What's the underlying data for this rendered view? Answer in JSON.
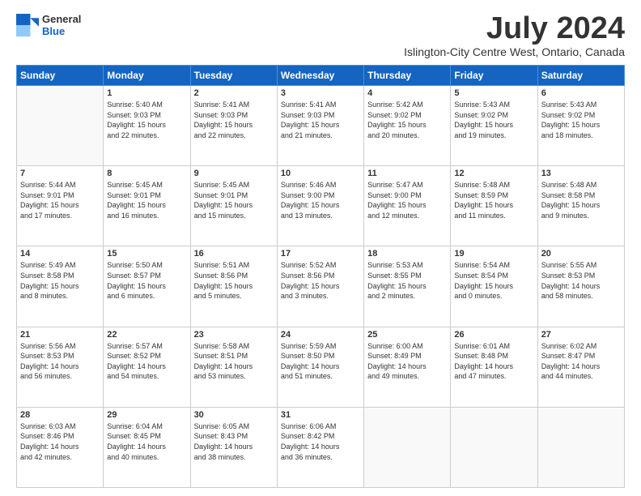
{
  "logo": {
    "line1": "General",
    "line2": "Blue"
  },
  "title": "July 2024",
  "subtitle": "Islington-City Centre West, Ontario, Canada",
  "weekdays": [
    "Sunday",
    "Monday",
    "Tuesday",
    "Wednesday",
    "Thursday",
    "Friday",
    "Saturday"
  ],
  "weeks": [
    [
      {
        "day": "",
        "sunrise": "",
        "sunset": "",
        "daylight": ""
      },
      {
        "day": "1",
        "sunrise": "Sunrise: 5:40 AM",
        "sunset": "Sunset: 9:03 PM",
        "daylight": "Daylight: 15 hours and 22 minutes."
      },
      {
        "day": "2",
        "sunrise": "Sunrise: 5:41 AM",
        "sunset": "Sunset: 9:03 PM",
        "daylight": "Daylight: 15 hours and 22 minutes."
      },
      {
        "day": "3",
        "sunrise": "Sunrise: 5:41 AM",
        "sunset": "Sunset: 9:03 PM",
        "daylight": "Daylight: 15 hours and 21 minutes."
      },
      {
        "day": "4",
        "sunrise": "Sunrise: 5:42 AM",
        "sunset": "Sunset: 9:02 PM",
        "daylight": "Daylight: 15 hours and 20 minutes."
      },
      {
        "day": "5",
        "sunrise": "Sunrise: 5:43 AM",
        "sunset": "Sunset: 9:02 PM",
        "daylight": "Daylight: 15 hours and 19 minutes."
      },
      {
        "day": "6",
        "sunrise": "Sunrise: 5:43 AM",
        "sunset": "Sunset: 9:02 PM",
        "daylight": "Daylight: 15 hours and 18 minutes."
      }
    ],
    [
      {
        "day": "7",
        "sunrise": "Sunrise: 5:44 AM",
        "sunset": "Sunset: 9:01 PM",
        "daylight": "Daylight: 15 hours and 17 minutes."
      },
      {
        "day": "8",
        "sunrise": "Sunrise: 5:45 AM",
        "sunset": "Sunset: 9:01 PM",
        "daylight": "Daylight: 15 hours and 16 minutes."
      },
      {
        "day": "9",
        "sunrise": "Sunrise: 5:45 AM",
        "sunset": "Sunset: 9:01 PM",
        "daylight": "Daylight: 15 hours and 15 minutes."
      },
      {
        "day": "10",
        "sunrise": "Sunrise: 5:46 AM",
        "sunset": "Sunset: 9:00 PM",
        "daylight": "Daylight: 15 hours and 13 minutes."
      },
      {
        "day": "11",
        "sunrise": "Sunrise: 5:47 AM",
        "sunset": "Sunset: 9:00 PM",
        "daylight": "Daylight: 15 hours and 12 minutes."
      },
      {
        "day": "12",
        "sunrise": "Sunrise: 5:48 AM",
        "sunset": "Sunset: 8:59 PM",
        "daylight": "Daylight: 15 hours and 11 minutes."
      },
      {
        "day": "13",
        "sunrise": "Sunrise: 5:48 AM",
        "sunset": "Sunset: 8:58 PM",
        "daylight": "Daylight: 15 hours and 9 minutes."
      }
    ],
    [
      {
        "day": "14",
        "sunrise": "Sunrise: 5:49 AM",
        "sunset": "Sunset: 8:58 PM",
        "daylight": "Daylight: 15 hours and 8 minutes."
      },
      {
        "day": "15",
        "sunrise": "Sunrise: 5:50 AM",
        "sunset": "Sunset: 8:57 PM",
        "daylight": "Daylight: 15 hours and 6 minutes."
      },
      {
        "day": "16",
        "sunrise": "Sunrise: 5:51 AM",
        "sunset": "Sunset: 8:56 PM",
        "daylight": "Daylight: 15 hours and 5 minutes."
      },
      {
        "day": "17",
        "sunrise": "Sunrise: 5:52 AM",
        "sunset": "Sunset: 8:56 PM",
        "daylight": "Daylight: 15 hours and 3 minutes."
      },
      {
        "day": "18",
        "sunrise": "Sunrise: 5:53 AM",
        "sunset": "Sunset: 8:55 PM",
        "daylight": "Daylight: 15 hours and 2 minutes."
      },
      {
        "day": "19",
        "sunrise": "Sunrise: 5:54 AM",
        "sunset": "Sunset: 8:54 PM",
        "daylight": "Daylight: 15 hours and 0 minutes."
      },
      {
        "day": "20",
        "sunrise": "Sunrise: 5:55 AM",
        "sunset": "Sunset: 8:53 PM",
        "daylight": "Daylight: 14 hours and 58 minutes."
      }
    ],
    [
      {
        "day": "21",
        "sunrise": "Sunrise: 5:56 AM",
        "sunset": "Sunset: 8:53 PM",
        "daylight": "Daylight: 14 hours and 56 minutes."
      },
      {
        "day": "22",
        "sunrise": "Sunrise: 5:57 AM",
        "sunset": "Sunset: 8:52 PM",
        "daylight": "Daylight: 14 hours and 54 minutes."
      },
      {
        "day": "23",
        "sunrise": "Sunrise: 5:58 AM",
        "sunset": "Sunset: 8:51 PM",
        "daylight": "Daylight: 14 hours and 53 minutes."
      },
      {
        "day": "24",
        "sunrise": "Sunrise: 5:59 AM",
        "sunset": "Sunset: 8:50 PM",
        "daylight": "Daylight: 14 hours and 51 minutes."
      },
      {
        "day": "25",
        "sunrise": "Sunrise: 6:00 AM",
        "sunset": "Sunset: 8:49 PM",
        "daylight": "Daylight: 14 hours and 49 minutes."
      },
      {
        "day": "26",
        "sunrise": "Sunrise: 6:01 AM",
        "sunset": "Sunset: 8:48 PM",
        "daylight": "Daylight: 14 hours and 47 minutes."
      },
      {
        "day": "27",
        "sunrise": "Sunrise: 6:02 AM",
        "sunset": "Sunset: 8:47 PM",
        "daylight": "Daylight: 14 hours and 44 minutes."
      }
    ],
    [
      {
        "day": "28",
        "sunrise": "Sunrise: 6:03 AM",
        "sunset": "Sunset: 8:46 PM",
        "daylight": "Daylight: 14 hours and 42 minutes."
      },
      {
        "day": "29",
        "sunrise": "Sunrise: 6:04 AM",
        "sunset": "Sunset: 8:45 PM",
        "daylight": "Daylight: 14 hours and 40 minutes."
      },
      {
        "day": "30",
        "sunrise": "Sunrise: 6:05 AM",
        "sunset": "Sunset: 8:43 PM",
        "daylight": "Daylight: 14 hours and 38 minutes."
      },
      {
        "day": "31",
        "sunrise": "Sunrise: 6:06 AM",
        "sunset": "Sunset: 8:42 PM",
        "daylight": "Daylight: 14 hours and 36 minutes."
      },
      {
        "day": "",
        "sunrise": "",
        "sunset": "",
        "daylight": ""
      },
      {
        "day": "",
        "sunrise": "",
        "sunset": "",
        "daylight": ""
      },
      {
        "day": "",
        "sunrise": "",
        "sunset": "",
        "daylight": ""
      }
    ]
  ]
}
